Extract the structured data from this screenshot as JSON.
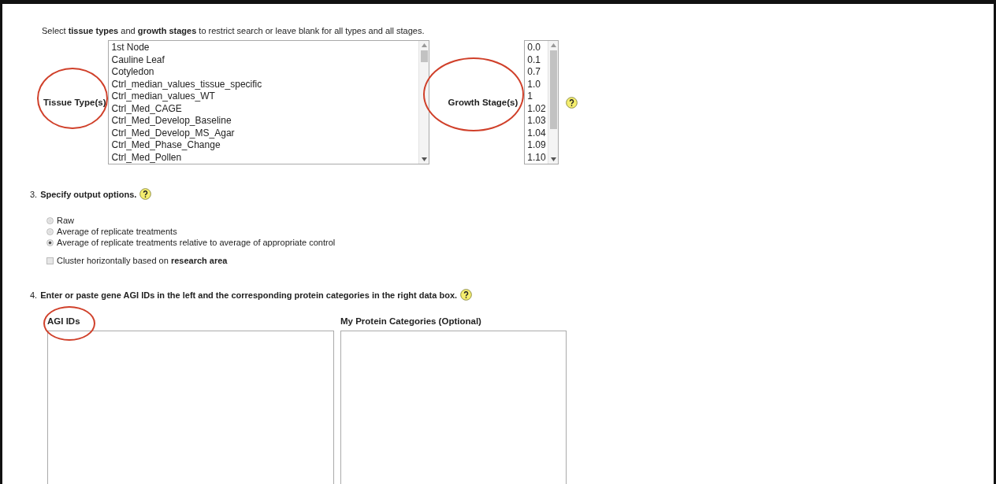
{
  "intro": "Select **tissue types** and **growth stages** to restrict search or leave blank for all types and all stages.",
  "tissue": {
    "label": "Tissue Type(s)",
    "circled": true,
    "options": [
      "1st Node",
      "Cauline Leaf",
      "Cotyledon",
      "Ctrl_median_values_tissue_specific",
      "Ctrl_median_values_WT",
      "Ctrl_Med_CAGE",
      "Ctrl_Med_Develop_Baseline",
      "Ctrl_Med_Develop_MS_Agar",
      "Ctrl_Med_Phase_Change",
      "Ctrl_Med_Pollen"
    ]
  },
  "stage": {
    "label": "Growth Stage(s)",
    "circled": true,
    "options": [
      "0.0",
      "0.1",
      "0.7",
      "1.0",
      "1",
      "1.02",
      "1.03",
      "1.04",
      "1.09",
      "1.10"
    ]
  },
  "output_section": {
    "number": "3.",
    "title": "Specify output options.",
    "options": [
      {
        "label": "Raw",
        "selected": false
      },
      {
        "label": "Average of replicate treatments",
        "selected": false
      },
      {
        "label": "Average of replicate treatments relative to average of appropriate control",
        "selected": true
      }
    ],
    "cluster": {
      "label": "Cluster horizontally based on **research area**",
      "checked": false
    }
  },
  "input_section": {
    "number": "4.",
    "title": "Enter or paste gene AGI IDs in the left and the corresponding protein categories in the right data box.",
    "fields": [
      {
        "label": "AGI IDs",
        "circled": true
      },
      {
        "label": "My Protein Categories (Optional)",
        "circled": false
      }
    ]
  }
}
